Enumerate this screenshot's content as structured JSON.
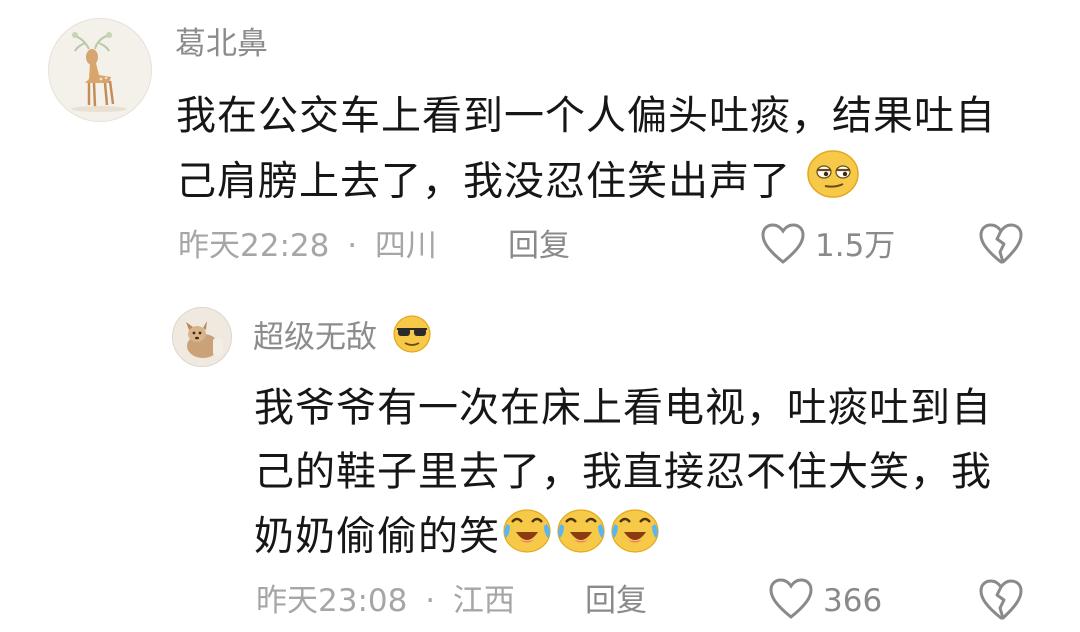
{
  "main_comment": {
    "username": "葛北鼻",
    "text_line1": "我在公交车上看到一个人偏头吐痰，结果吐自",
    "text_line2": "己肩膀上去了，我没忍住笑出声了",
    "emoji": "smirk-emoji",
    "time": "昨天22:28",
    "separator": "·",
    "location": "四川",
    "reply_label": "回复",
    "like_count": "1.5万"
  },
  "reply_comment": {
    "username": "超级无敌",
    "username_emoji": "cool-emoji",
    "text_line1": "我爷爷有一次在床上看电视，吐痰吐到自",
    "text_line2": "己的鞋子里去了，我直接忍不住大笑，我",
    "text_line3": "奶奶偷偷的笑",
    "emojis": [
      "laugh-cry-emoji",
      "laugh-cry-emoji",
      "laugh-cry-emoji"
    ],
    "time": "昨天23:08",
    "separator": "·",
    "location": "江西",
    "reply_label": "回复",
    "like_count": "366"
  },
  "colors": {
    "meta_gray": "#a6a6a6",
    "name_gray": "#8c8c8c",
    "text": "#161616",
    "emoji_yellow": "#f7c948"
  }
}
